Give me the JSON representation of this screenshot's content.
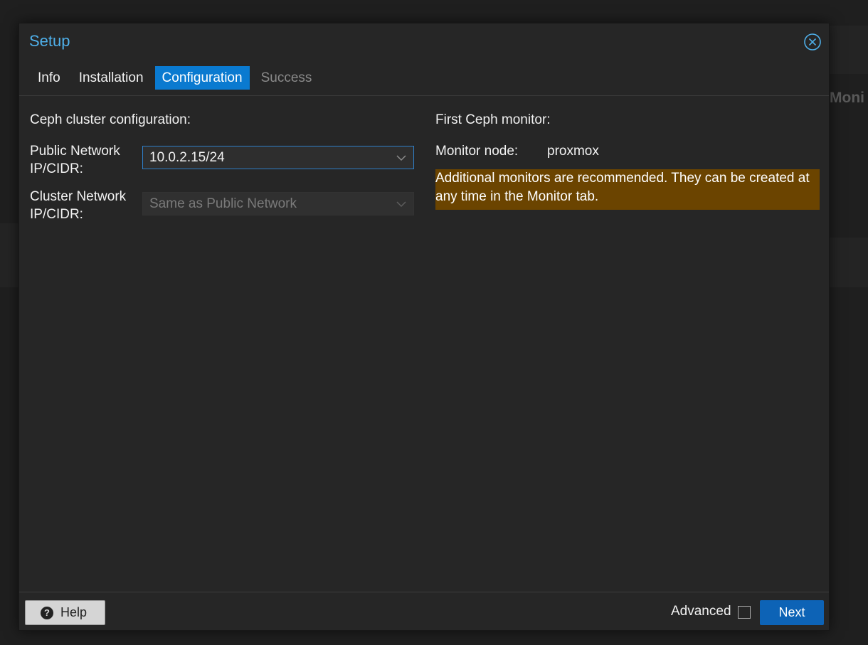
{
  "background": {
    "monitor_partial_text": "Moni"
  },
  "dialog": {
    "title": "Setup",
    "close_icon": "close-circle-icon"
  },
  "tabs": [
    {
      "label": "Info",
      "state": "normal"
    },
    {
      "label": "Installation",
      "state": "normal"
    },
    {
      "label": "Configuration",
      "state": "active"
    },
    {
      "label": "Success",
      "state": "disabled"
    }
  ],
  "left": {
    "section_title": "Ceph cluster configuration:",
    "public_network": {
      "label_line1": "Public Network",
      "label_line2": "IP/CIDR:",
      "value": "10.0.2.15/24"
    },
    "cluster_network": {
      "label_line1": "Cluster Network",
      "label_line2": "IP/CIDR:",
      "value": "Same as Public Network"
    }
  },
  "right": {
    "section_title": "First Ceph monitor:",
    "monitor_node_label": "Monitor node:",
    "monitor_node_value": "proxmox",
    "warning_line1": "Additional monitors are recommended. They can be created at",
    "warning_line2": "any time in the Monitor tab."
  },
  "footer": {
    "help_label": "Help",
    "help_icon": "question-circle-icon",
    "advanced_label": "Advanced",
    "advanced_checked": false,
    "next_label": "Next"
  },
  "colors": {
    "accent": "#0a7ad0",
    "title": "#4fb0ea",
    "warning_bg": "#6b4400",
    "next_bg": "#0d63b6"
  }
}
